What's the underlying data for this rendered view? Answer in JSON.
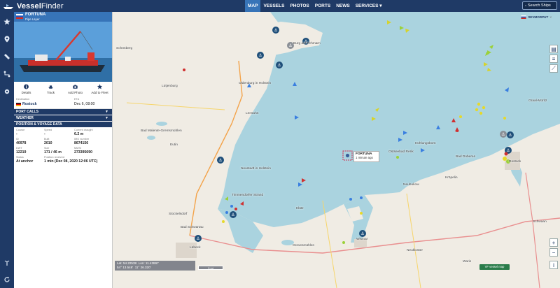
{
  "brand": {
    "name_bold": "Vessel",
    "name_light": "Finder"
  },
  "nav": {
    "items": [
      "MAP",
      "VESSELS",
      "PHOTOS",
      "PORTS",
      "NEWS",
      "SERVICES ▾"
    ],
    "active": "MAP"
  },
  "search": {
    "placeholder": "Search Ships"
  },
  "sidebar": {
    "icons": [
      "star-icon",
      "location-pin-icon",
      "ruler-icon",
      "route-icon",
      "settings-icon",
      "antenna-icon",
      "refresh-icon"
    ]
  },
  "vessel": {
    "name": "FORTUNA",
    "type": "Pipe Layer",
    "flag_country": "Russia",
    "actions": [
      "Details",
      "Track",
      "Add Photo",
      "Add to Fleet"
    ],
    "destination_label": "Destination",
    "destination": "Rostock",
    "eta_label": "ETA",
    "eta": "Dec 6, 08:00",
    "sections": [
      "PORT CALLS",
      "WEATHER",
      "POSITION & VOYAGE DATA"
    ],
    "fields": {
      "course_label": "Course",
      "course": "-",
      "speed_label": "Speed",
      "speed": "-",
      "draught_label": "Current draught",
      "draught": "6.2 m",
      "id_label": "ID",
      "id": "40978",
      "built_label": "Built",
      "built": "2010",
      "imo_label": "IMO number",
      "imo": "8674156",
      "dwt_label": "DWT",
      "dwt": "12219",
      "size_label": "Size",
      "size": "171 / 46 m",
      "mmsi_label": "MMSI",
      "mmsi": "273395690",
      "status_label": "Status",
      "status": "At anchor",
      "received_label": "Position received",
      "received": "1 min (Dec 08, 2020 12:06 UTC)"
    }
  },
  "map": {
    "sea_badge": "SEVMORPUT",
    "fortuna_label": {
      "name": "FORTUNA",
      "time": "1 minute ago"
    },
    "places": [
      "Burg auf Fehmarn",
      "Schönberg",
      "Oldenburg in Holstein",
      "Lütjenburg",
      "Lensahn",
      "Bad Malente-Gremsmühlen",
      "Eutin",
      "Bad Schwartau",
      "Lübeck",
      "Neustadt in Holstein",
      "Stockelsdorf",
      "Timmendorfer Strand",
      "Klütz",
      "Grevesmühlen",
      "Wismar",
      "Neubukow",
      "Kröpelin",
      "Bad Doberan",
      "Kühlungsborn",
      "Ostseebad Rerik",
      "Neukloster",
      "Rostock",
      "Graal-Müritz",
      "Schwaan",
      "Warin"
    ],
    "coords": {
      "lat": "Lat: 54.22538",
      "lon": "Lon: 11.43867",
      "lat_dm": "54° 13.546'",
      "lon_dm": "11° 26.320'"
    },
    "scale": "5 mi",
    "green_button": "VF vessel map",
    "colors": {
      "sea": "#aad3df",
      "land": "#f0ece4",
      "ui": "#1f3a66",
      "accent": "#3774b8"
    }
  }
}
